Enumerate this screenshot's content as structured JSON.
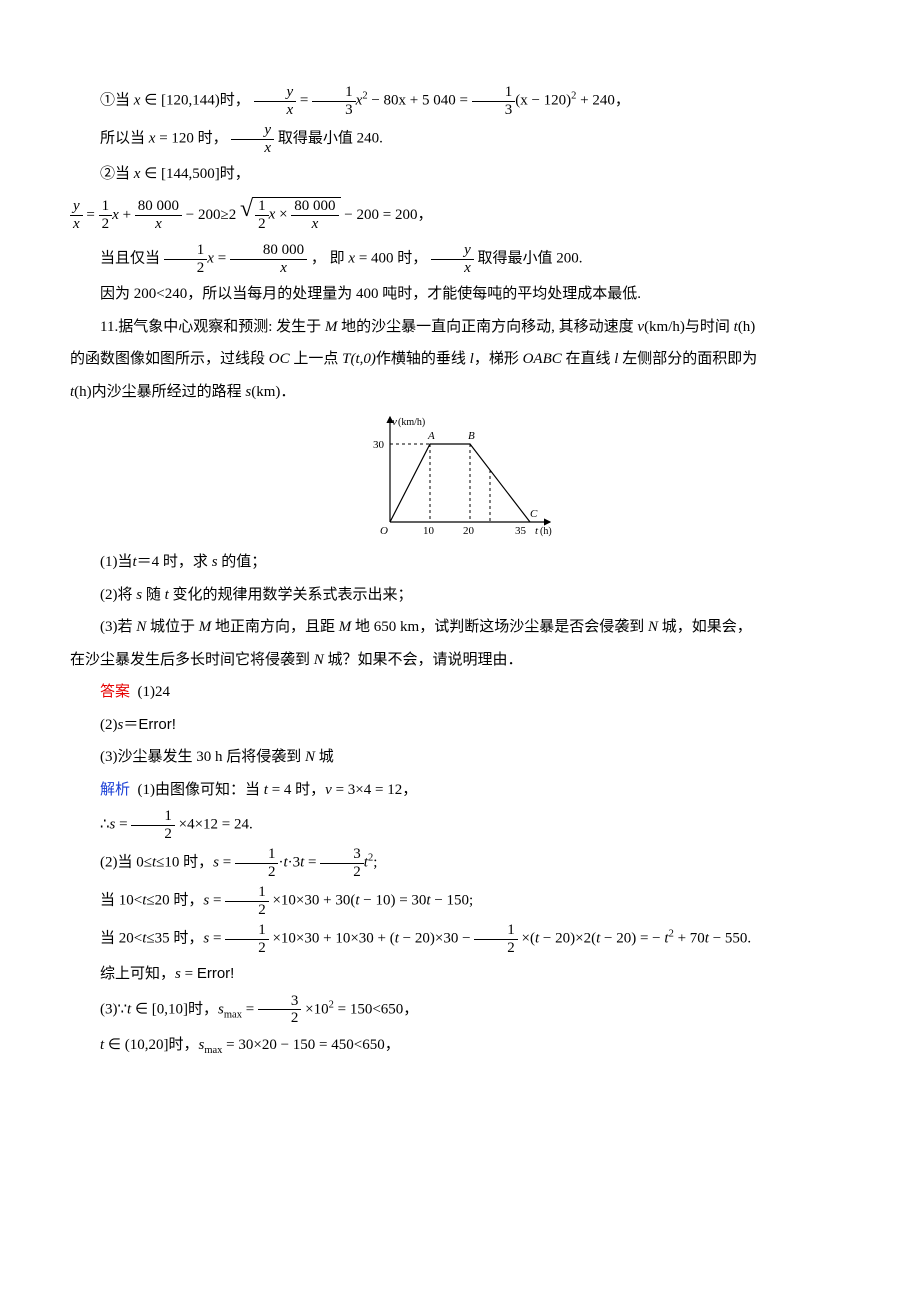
{
  "lines": {
    "l1a": "①当 ",
    "l1b": " ∈ [120,144)时，",
    "l1c": " = ",
    "l1d": " − 80x + 5 040 = ",
    "l1e": "(x − 120)",
    "l1f": " + 240，",
    "l2a": "所以当 ",
    "l2b": " = 120 时，",
    "l2c": "取得最小值 240.",
    "l3a": "②当 ",
    "l3b": " ∈ [144,500]时，",
    "l4a": " = ",
    "l4b": " + ",
    "l4c": " − 200≥2 ",
    "l4d": " × ",
    "l4e": " − 200 = 200，",
    "l5a": "当且仅当 ",
    "l5b": " = ",
    "l5c": "， 即 ",
    "l5d": " = 400 时，",
    "l5e": "取得最小值 200.",
    "l6": "因为 200<240，所以当每月的处理量为 400 吨时，才能使每吨的平均处理成本最低.",
    "p11a": "11.据气象中心观察和预测: 发生于 ",
    "p11b": " 地的沙尘暴一直向正南方向移动, 其移动速度 ",
    "p11c": "(km/h)与时间 ",
    "p11d": "(h)",
    "p11e": "的函数图像如图所示，过线段 ",
    "p11f": " 上一点 ",
    "p11g": "作横轴的垂线 ",
    "p11h": "，梯形 ",
    "p11i": " 在直线 ",
    "p11j": " 左侧部分的面积即为",
    "p11k": "(h)内沙尘暴所经过的路程 ",
    "p11l": "(km)．",
    "q1": "(1)当",
    "q1b": "＝4 时，求 ",
    "q1c": " 的值；",
    "q2": "(2)将 ",
    "q2b": " 随 ",
    "q2c": " 变化的规律用数学关系式表示出来；",
    "q3a": "(3)若 ",
    "q3b": " 城位于 ",
    "q3c": " 地正南方向，且距 ",
    "q3d": " 地 650 km，试判断这场沙尘暴是否会侵袭到 ",
    "q3e": " 城，如果会，",
    "q3f": "在沙尘暴发生后多长时间它将侵袭到 ",
    "q3g": " 城？如果不会，请说明理由．",
    "ans_label": "答案",
    "ans1": "(1)24",
    "ans2a": "(2)",
    "ans2b": "＝",
    "err": "Error!",
    "ans3a": "(3)沙尘暴发生 30 h 后将侵袭到 ",
    "ans3b": " 城",
    "ana_label": "解析",
    "ana1a": "(1)由图像可知：当 ",
    "ana1b": " = 4 时，",
    "ana1c": " = 3×4 = 12，",
    "ana2a": "∴",
    "ana2b": " = ",
    "ana2c": "×4×12 = 24.",
    "ana3a": "(2)当 0≤",
    "ana3b": "≤10 时，",
    "ana3c": " = ",
    "ana3d": "·",
    "ana3e": "·3",
    "ana3f": " = ",
    "ana3g": ";",
    "ana4a": "当 10<",
    "ana4b": "≤20 时，",
    "ana4c": " = ",
    "ana4d": "×10×30 + 30(",
    "ana4e": " − 10) = 30",
    "ana4f": " − 150;",
    "ana5a": "当 20<",
    "ana5b": "≤35 时，",
    "ana5c": " = ",
    "ana5d": "×10×30 + 10×30 + (",
    "ana5e": " − 20)×30 − ",
    "ana5f": "×(",
    "ana5g": " − 20)×2(",
    "ana5h": " − 20) = − ",
    "ana5i": " + 70",
    "ana5j": " − 550.",
    "ana6a": "综上可知，",
    "ana6b": " = ",
    "ana7a": "(3)∵",
    "ana7b": " ∈ [0,10]时，",
    "ana7c": " = ",
    "ana7d": "×10",
    "ana7e": " = 150<650，",
    "ana8a": " ∈ (10,20]时，",
    "ana8b": " = 30×20 − 150 = 450<650，"
  },
  "vars": {
    "x": "x",
    "y": "y",
    "t": "t",
    "s": "s",
    "v": "v",
    "l": "l",
    "M": "M",
    "N": "N",
    "OC": "OC",
    "T": "T",
    "Ttuple": "(t,0)",
    "OABC": "OABC",
    "smax": "max"
  },
  "frac": {
    "one": "1",
    "two": "2",
    "three": "3",
    "eighty_thousand": "80 000",
    "num_y": "y",
    "num_x": "x"
  },
  "chart_data": {
    "type": "line",
    "title": "",
    "xlabel": "t(h)",
    "ylabel": "v(km/h)",
    "points": {
      "O": {
        "x": 0,
        "y": 0,
        "label": "O"
      },
      "A": {
        "x": 10,
        "y": 30,
        "label": "A"
      },
      "B": {
        "x": 20,
        "y": 30,
        "label": "B"
      },
      "C": {
        "x": 35,
        "y": 0,
        "label": "C"
      }
    },
    "x_ticks": [
      10,
      20,
      35
    ],
    "y_ticks": [
      30
    ],
    "ylim": [
      0,
      32
    ],
    "xlim": [
      0,
      40
    ],
    "dashed_verticals_at": [
      10,
      20,
      25
    ]
  }
}
